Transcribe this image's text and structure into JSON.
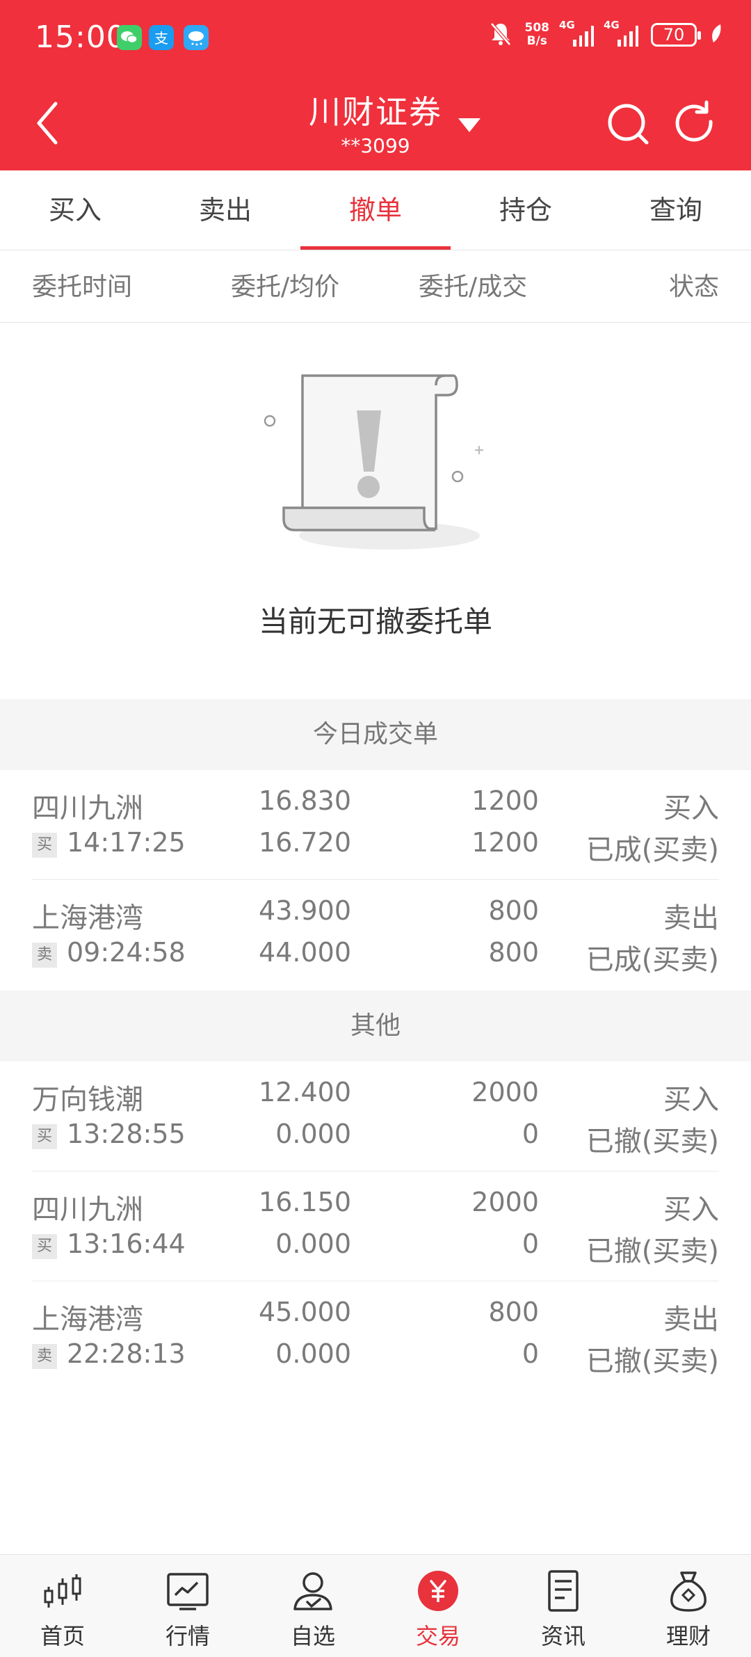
{
  "status_bar": {
    "time": "15:00",
    "net_speed_value": "508",
    "net_speed_unit": "B/s",
    "signal1_label": "4G",
    "signal2_label": "4G",
    "battery": "70",
    "app_badges": [
      "wechat-icon",
      "alipay-icon",
      "weather-icon"
    ]
  },
  "nav": {
    "title": "川财证券",
    "account": "**3099"
  },
  "tabs": [
    "买入",
    "卖出",
    "撤单",
    "持仓",
    "查询"
  ],
  "active_tab": "撤单",
  "columns": [
    "委托时间",
    "委托/均价",
    "委托/成交",
    "状态"
  ],
  "empty_state": {
    "message": "当前无可撤委托单"
  },
  "sections": {
    "today": {
      "title": "今日成交单",
      "orders": [
        {
          "name": "四川九洲",
          "badge": "买",
          "time": "14:17:25",
          "price1": "16.830",
          "price2": "16.720",
          "qty1": "1200",
          "qty2": "1200",
          "side": "买入",
          "status": "已成(买卖)"
        },
        {
          "name": "上海港湾",
          "badge": "卖",
          "time": "09:24:58",
          "price1": "43.900",
          "price2": "44.000",
          "qty1": "800",
          "qty2": "800",
          "side": "卖出",
          "status": "已成(买卖)"
        }
      ]
    },
    "other": {
      "title": "其他",
      "orders": [
        {
          "name": "万向钱潮",
          "badge": "买",
          "time": "13:28:55",
          "price1": "12.400",
          "price2": "0.000",
          "qty1": "2000",
          "qty2": "0",
          "side": "买入",
          "status": "已撤(买卖)"
        },
        {
          "name": "四川九洲",
          "badge": "买",
          "time": "13:16:44",
          "price1": "16.150",
          "price2": "0.000",
          "qty1": "2000",
          "qty2": "0",
          "side": "买入",
          "status": "已撤(买卖)"
        },
        {
          "name": "上海港湾",
          "badge": "卖",
          "time": "22:28:13",
          "price1": "45.000",
          "price2": "0.000",
          "qty1": "800",
          "qty2": "0",
          "side": "卖出",
          "status": "已撤(买卖)"
        }
      ]
    }
  },
  "bottom_nav": [
    {
      "label": "首页",
      "icon": "candlestick-icon"
    },
    {
      "label": "行情",
      "icon": "chart-icon"
    },
    {
      "label": "自选",
      "icon": "user-check-icon"
    },
    {
      "label": "交易",
      "icon": "yuan-icon"
    },
    {
      "label": "资讯",
      "icon": "document-icon"
    },
    {
      "label": "理财",
      "icon": "money-bag-icon"
    }
  ],
  "colors": {
    "brand": "#f0303c",
    "accent": "#e8323c"
  }
}
